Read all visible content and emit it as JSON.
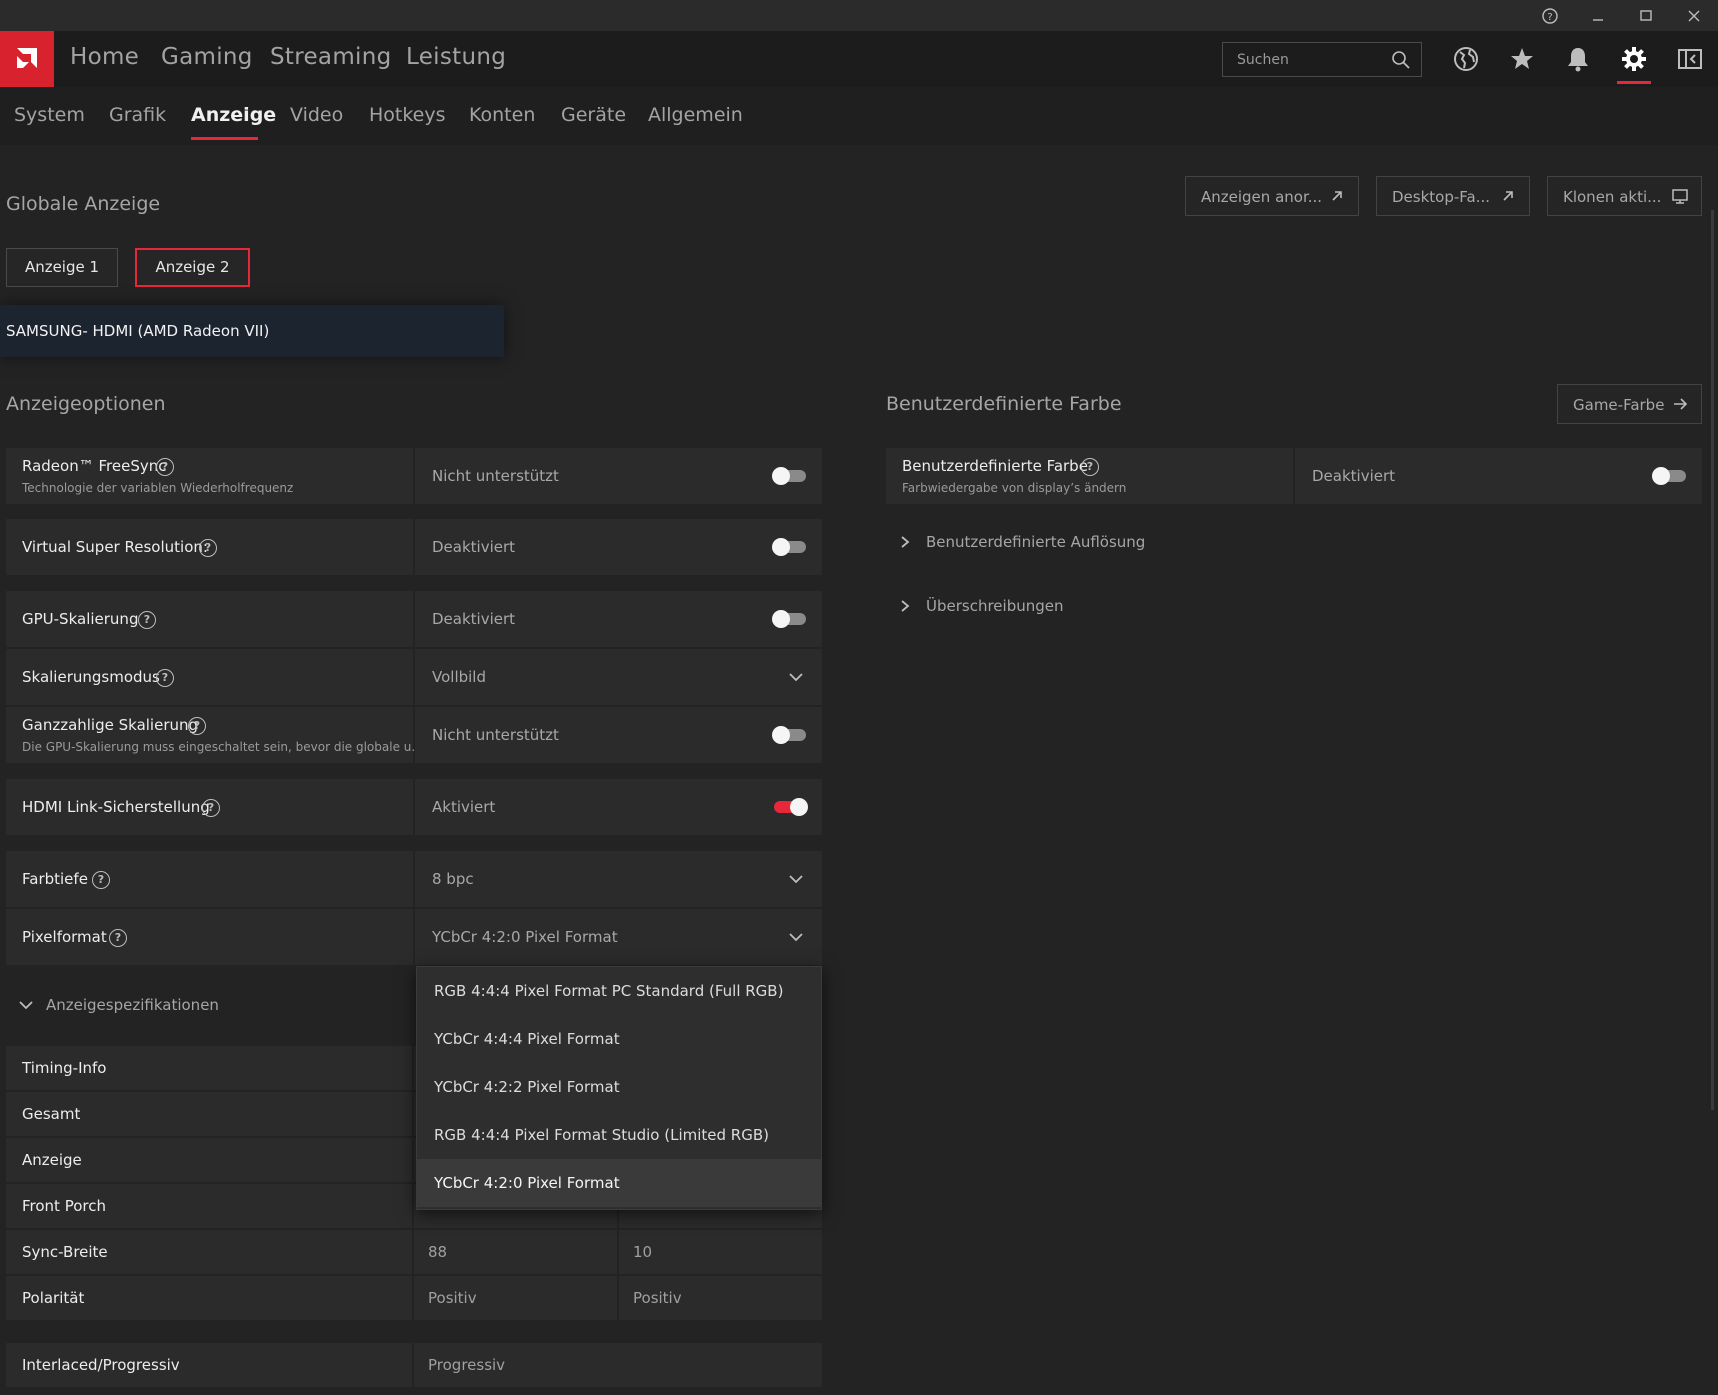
{
  "titlebar": {
    "help_icon": "help-circle-icon",
    "minimize_icon": "minimize-icon",
    "maximize_icon": "maximize-icon",
    "close_icon": "close-icon"
  },
  "topnav": {
    "items": [
      "Home",
      "Gaming",
      "Streaming",
      "Leistung"
    ],
    "search_placeholder": "Suchen",
    "icons": [
      "globe-icon",
      "star-icon",
      "bell-icon",
      "gear-icon",
      "sidebar-icon"
    ],
    "accent": "#e8283a",
    "logo_color": "#d8232e"
  },
  "subnav": {
    "items": [
      "System",
      "Grafik",
      "Anzeige",
      "Video",
      "Hotkeys",
      "Konten",
      "Geräte",
      "Allgemein"
    ],
    "active": "Anzeige"
  },
  "global": {
    "title": "Globale Anzeige",
    "buttons": [
      "Anzeigen anor...",
      "Desktop-Fa...",
      "Klonen akti..."
    ],
    "displays": [
      "Anzeige 1",
      "Anzeige 2"
    ],
    "selected_display": "Anzeige 2",
    "monitor": "SAMSUNG- HDMI (AMD Radeon VII)"
  },
  "options": {
    "title": "Anzeigeoptionen",
    "rows": [
      {
        "label": "Radeon™ FreeSync",
        "sub": "Technologie der variablen Wiederholfrequenz",
        "value": "Nicht unterstützt",
        "control": "toggle",
        "on": false
      },
      {
        "label": "Virtual Super Resolution:",
        "value": "Deaktiviert",
        "control": "toggle",
        "on": false
      },
      {
        "label": "GPU-Skalierung",
        "value": "Deaktiviert",
        "control": "toggle",
        "on": false
      },
      {
        "label": "Skalierungsmodus",
        "value": "Vollbild",
        "control": "dropdown"
      },
      {
        "label": "Ganzzahlige Skalierung",
        "sub": "Die GPU-Skalierung muss eingeschaltet sein, bevor die globale u...",
        "value": "Nicht unterstützt",
        "control": "toggle",
        "on": false
      },
      {
        "label": "HDMI Link-Sicherstellung",
        "value": "Aktiviert",
        "control": "toggle",
        "on": true
      },
      {
        "label": "Farbtiefe",
        "value": "8 bpc",
        "control": "dropdown"
      },
      {
        "label": "Pixelformat",
        "value": "YCbCr 4:2:0 Pixel Format",
        "control": "dropdown"
      }
    ]
  },
  "pixel_dropdown": {
    "options": [
      "RGB 4:4:4 Pixel Format PC Standard (Full RGB)",
      "YCbCr 4:4:4 Pixel Format",
      "YCbCr 4:2:2 Pixel Format",
      "RGB 4:4:4 Pixel Format Studio (Limited RGB)",
      "YCbCr 4:2:0 Pixel Format"
    ],
    "selected": "YCbCr 4:2:0 Pixel Format"
  },
  "specs": {
    "title": "Anzeigespezifikationen",
    "rows": [
      {
        "label": "Timing-Info",
        "v1": "",
        "v2": ""
      },
      {
        "label": "Gesamt",
        "v1": "",
        "v2": ""
      },
      {
        "label": "Anzeige",
        "v1": "",
        "v2": ""
      },
      {
        "label": "Front Porch",
        "v1": "",
        "v2": ""
      },
      {
        "label": "Sync-Breite",
        "v1": "88",
        "v2": "10"
      },
      {
        "label": "Polarität",
        "v1": "Positiv",
        "v2": "Positiv"
      },
      {
        "label": "Interlaced/Progressiv",
        "v1": "Progressiv",
        "v2": ""
      }
    ]
  },
  "custom_color": {
    "title": "Benutzerdefinierte Farbe",
    "game_color_button": "Game-Farbe",
    "row": {
      "label": "Benutzerdefinierte Farbe",
      "sub": "Farbwiedergabe von display’s ändern",
      "value": "Deaktiviert",
      "on": false
    },
    "expanders": [
      "Benutzerdefinierte Auflösung",
      "Überschreibungen"
    ]
  }
}
